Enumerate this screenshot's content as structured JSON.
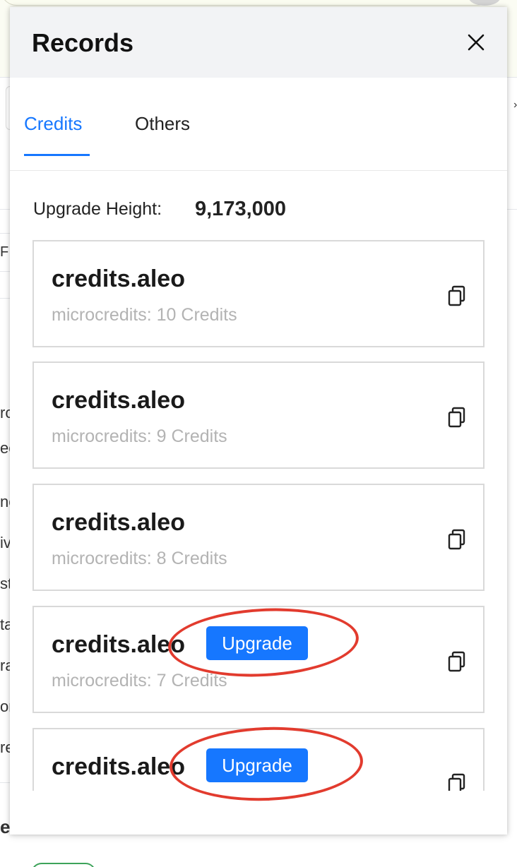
{
  "drawer": {
    "title": "Records",
    "close_icon": "close-icon"
  },
  "tabs": [
    {
      "label": "Credits",
      "active": true
    },
    {
      "label": "Others",
      "active": false
    }
  ],
  "upgrade_height": {
    "label": "Upgrade Height:",
    "value": "9,173,000"
  },
  "records": [
    {
      "title": "credits.aleo",
      "subtitle": "microcredits: 10 Credits",
      "upgrade": false
    },
    {
      "title": "credits.aleo",
      "subtitle": "microcredits: 9 Credits",
      "upgrade": false
    },
    {
      "title": "credits.aleo",
      "subtitle": "microcredits: 8 Credits",
      "upgrade": false
    },
    {
      "title": "credits.aleo",
      "subtitle": "microcredits: 7 Credits",
      "upgrade": true,
      "upgrade_label": "Upgrade"
    },
    {
      "title": "credits.aleo",
      "subtitle": "",
      "upgrade": true,
      "upgrade_label": "Upgrade"
    }
  ],
  "colors": {
    "accent": "#1677ff",
    "annotation": "#e23b2e"
  },
  "background_fragments": [
    "F",
    "rc",
    "ec",
    "nc",
    "iv",
    "st",
    "ta",
    "ra",
    "or",
    "re",
    "e"
  ]
}
